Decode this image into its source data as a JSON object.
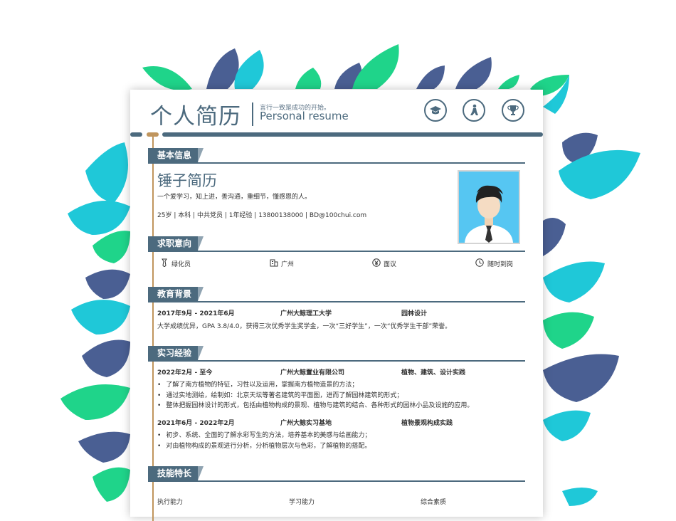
{
  "header": {
    "title_cn": "个人简历",
    "slogan": "言行一致是成功的开始。",
    "title_en": "Personal resume",
    "icons": [
      "graduation-cap-icon",
      "person-walking-icon",
      "trophy-icon"
    ]
  },
  "colors": {
    "primary": "#4c6a7e",
    "accent": "#c0955d",
    "leaf_teal": "#1fc8d8",
    "leaf_green": "#1fd48a",
    "leaf_navy": "#4a5f93"
  },
  "sections": {
    "basic": "基本信息",
    "intent": "求职意向",
    "education": "教育背景",
    "internship": "实习经验",
    "skills": "技能特长"
  },
  "basic": {
    "name": "锤子简历",
    "motto": "一个爱学习，知上进，善沟通，重细节，懂感恩的人。",
    "info": "25岁 | 本科 | 中共党员 | 1年经验 | 13800138000 | BD@100chui.com"
  },
  "intent": [
    {
      "icon": "tie-icon",
      "label": "绿化员"
    },
    {
      "icon": "building-icon",
      "label": "广州"
    },
    {
      "icon": "yen-icon",
      "label": "面议"
    },
    {
      "icon": "clock-icon",
      "label": "随时到岗"
    }
  ],
  "education": {
    "date": "2017年9月 - 2021年6月",
    "school": "广州大鲸理工大学",
    "major": "园林设计",
    "desc": "大学成绩优异，GPA 3.8/4.0，获得三次优秀学生奖学金，一次“三好学生”，一次“优秀学生干部”荣誉。"
  },
  "internships": [
    {
      "date": "2022年2月 - 至今",
      "company": "广州大鲸置业有限公司",
      "role": "植物、建筑、设计实践",
      "bullets": [
        "了解了南方植物的特征，习性以及运用，掌握南方植物造景的方法；",
        "通过实地测绘，绘制如：北京天坛等著名建筑的平面图，进而了解园林建筑的形式；",
        "整体把握园林设计的形式，包括由植物构成的景观、植物与建筑的结合、各种形式的园林小品及设施的应用。"
      ]
    },
    {
      "date": "2021年6月 - 2022年2月",
      "company": "广州大鲸实习基地",
      "role": "植物景观构成实践",
      "bullets": [
        "初步、系统、全面的了解水彩写生的方法，培养基本的美感与绘画能力；",
        "对由植物构成的景观进行分析，分析植物层次与色彩，了解植物的搭配。"
      ]
    }
  ],
  "skills": [
    "执行能力",
    "学习能力",
    "综合素质"
  ]
}
